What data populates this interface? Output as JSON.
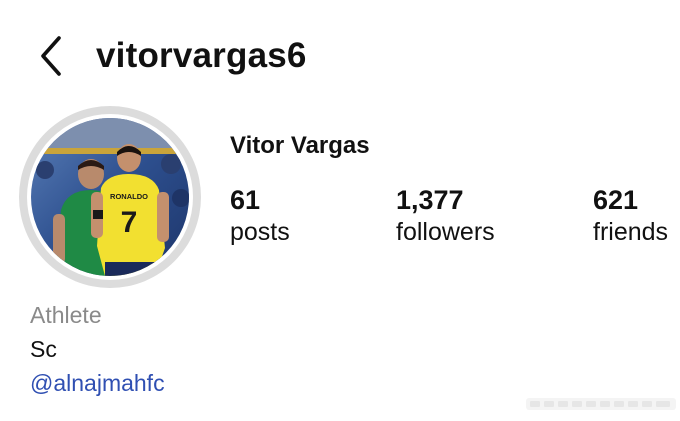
{
  "header": {
    "username": "vitorvargas6",
    "back_icon": "chevron-left-icon"
  },
  "profile": {
    "display_name": "Vitor Vargas",
    "avatar_description_icon": "profile-photo",
    "stats": [
      {
        "value": "61",
        "label": "posts"
      },
      {
        "value": "1,377",
        "label": "followers"
      },
      {
        "value": "621",
        "label": "friends"
      }
    ],
    "category": "Athlete",
    "bio": "Sc",
    "link": "@alnajmahfc",
    "jersey_name": "RONALDO",
    "jersey_number": "7"
  },
  "colors": {
    "link": "#2f4fb2",
    "category": "#8a8a8a",
    "text": "#111111"
  }
}
